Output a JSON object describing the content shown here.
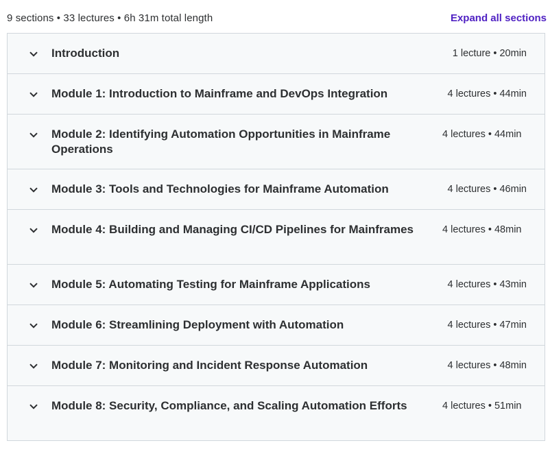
{
  "header": {
    "summary": "9 sections • 33 lectures • 6h 31m total length",
    "expand_all": "Expand all sections"
  },
  "sections": [
    {
      "title": "Introduction",
      "meta": "1 lecture • 20min"
    },
    {
      "title": "Module 1: Introduction to Mainframe and DevOps Integration",
      "meta": "4 lectures • 44min"
    },
    {
      "title": "Module 2: Identifying Automation Opportunities in Mainframe Operations",
      "meta": "4 lectures • 44min"
    },
    {
      "title": "Module 3: Tools and Technologies for Mainframe Automation",
      "meta": "4 lectures • 46min"
    },
    {
      "title": "Module 4: Building and Managing CI/CD Pipelines for Mainframes",
      "meta": "4 lectures • 48min"
    },
    {
      "title": "Module 5: Automating Testing for Mainframe Applications",
      "meta": "4 lectures • 43min"
    },
    {
      "title": "Module 6: Streamlining Deployment with Automation",
      "meta": "4 lectures • 47min"
    },
    {
      "title": "Module 7: Monitoring and Incident Response Automation",
      "meta": "4 lectures • 48min"
    },
    {
      "title": "Module 8: Security, Compliance, and Scaling Automation Efforts",
      "meta": "4 lectures • 51min"
    }
  ],
  "icons": {
    "section_toggle": "chevron-down-icon"
  },
  "colors": {
    "accent": "#5022c3",
    "text": "#2d2f31",
    "section_bg": "#f7f9fa",
    "border": "#d1d7dc"
  }
}
